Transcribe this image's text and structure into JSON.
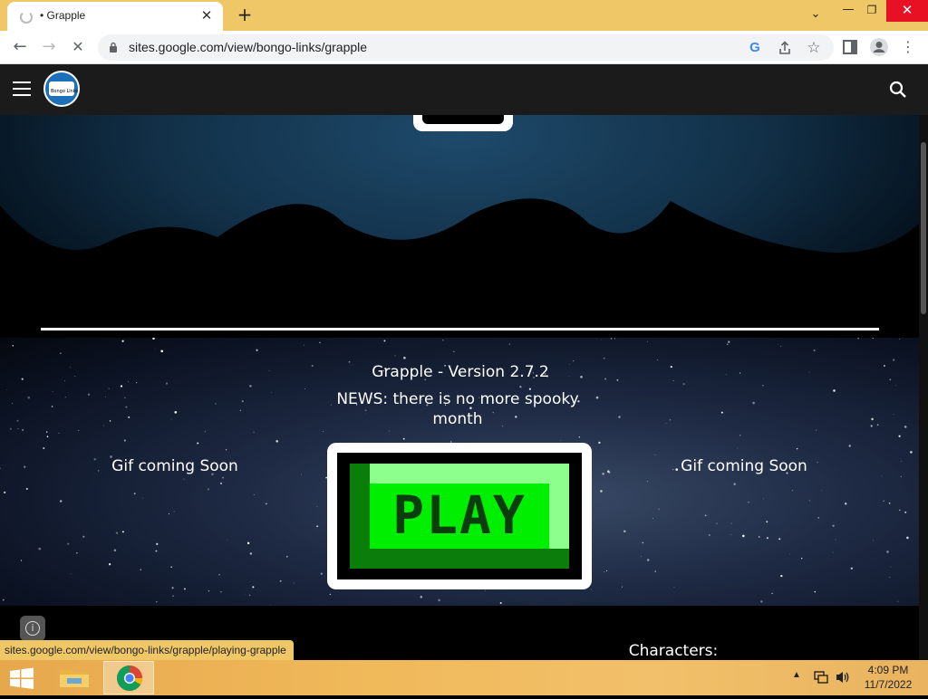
{
  "browser": {
    "tab_title": "• Grapple",
    "url": "sites.google.com/view/bongo-links/grapple",
    "status_url": "sites.google.com/view/bongo-links/grapple/playing-grapple",
    "close_tab": "✕",
    "new_tab": "+",
    "window_chevron": "⌄",
    "minimize": "—",
    "maximize": "❐",
    "close_window": "✕",
    "back": "←",
    "forward": "→",
    "reload": "✕"
  },
  "site": {
    "logo_text": "Bongo Links"
  },
  "main": {
    "version_title": "Grapple - Version 2.7.2",
    "news_line1": "NEWS: there is no more spooky",
    "news_line2": "month",
    "gif_left": "Gif coming Soon",
    "gif_right": "Gif coming Soon",
    "play_label": "PLAY",
    "characters_heading": "Characters:"
  },
  "taskbar": {
    "time": "4:09 PM",
    "date": "11/7/2022"
  },
  "colors": {
    "tabbar": "#f0c766",
    "site_header": "#1b1b1b",
    "play_green": "#00ee00",
    "play_text": "#0c3d0c"
  }
}
